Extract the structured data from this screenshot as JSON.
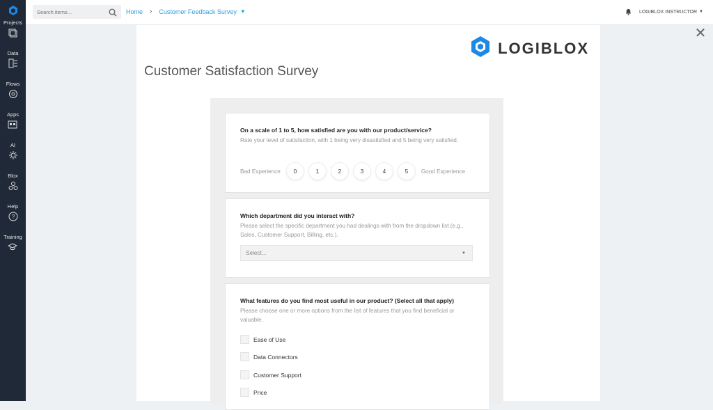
{
  "sidebar": {
    "items": [
      {
        "label": "Projects",
        "icon": "projects-icon"
      },
      {
        "label": "Data",
        "icon": "data-icon"
      },
      {
        "label": "Flows",
        "icon": "flows-icon"
      },
      {
        "label": "Apps",
        "icon": "apps-icon"
      },
      {
        "label": "AI",
        "icon": "ai-icon"
      },
      {
        "label": "Blox",
        "icon": "blox-icon"
      },
      {
        "label": "Help",
        "icon": "help-icon"
      },
      {
        "label": "Training",
        "icon": "training-icon"
      }
    ]
  },
  "header": {
    "search_placeholder": "Search items...",
    "breadcrumb": {
      "home": "Home",
      "sep": "›",
      "current": "Customer Feedback Survey",
      "caret": "▼"
    },
    "user_name": "LOGIBLOX INSTRUCTOR",
    "user_caret": "▼"
  },
  "page": {
    "close_glyph": "✕",
    "logo_word": "LOGIBLOX",
    "title": "Customer Satisfaction Survey"
  },
  "survey": {
    "q1": {
      "question": "On a scale of 1 to 5, how satisfied are you with our product/service?",
      "description": "Rate your level of satisfaction, with 1 being very dissatisfied and 5 being very satisfied.",
      "low_label": "Bad Experience",
      "high_label": "Good Experience",
      "options": [
        "0",
        "1",
        "2",
        "3",
        "4",
        "5"
      ]
    },
    "q2": {
      "question": "Which department did you interact with?",
      "description": "Please select the specific department you had dealings with from the dropdown list (e.g., Sales, Customer Support, Billing, etc.).",
      "select_value": "Select...",
      "arrow": "▼"
    },
    "q3": {
      "question": "What features do you find most useful in our product? (Select all that apply)",
      "description": "Please choose one or more options from the list of features that you find beneficial or valuable.",
      "options": [
        "Ease of Use",
        "Data Connectors",
        "Customer Support",
        "Price"
      ]
    }
  },
  "colors": {
    "accent": "#2a9fd8",
    "rail": "#1f2937",
    "logo_blue": "#1e88e5",
    "logo_green": "#2ecc71"
  }
}
